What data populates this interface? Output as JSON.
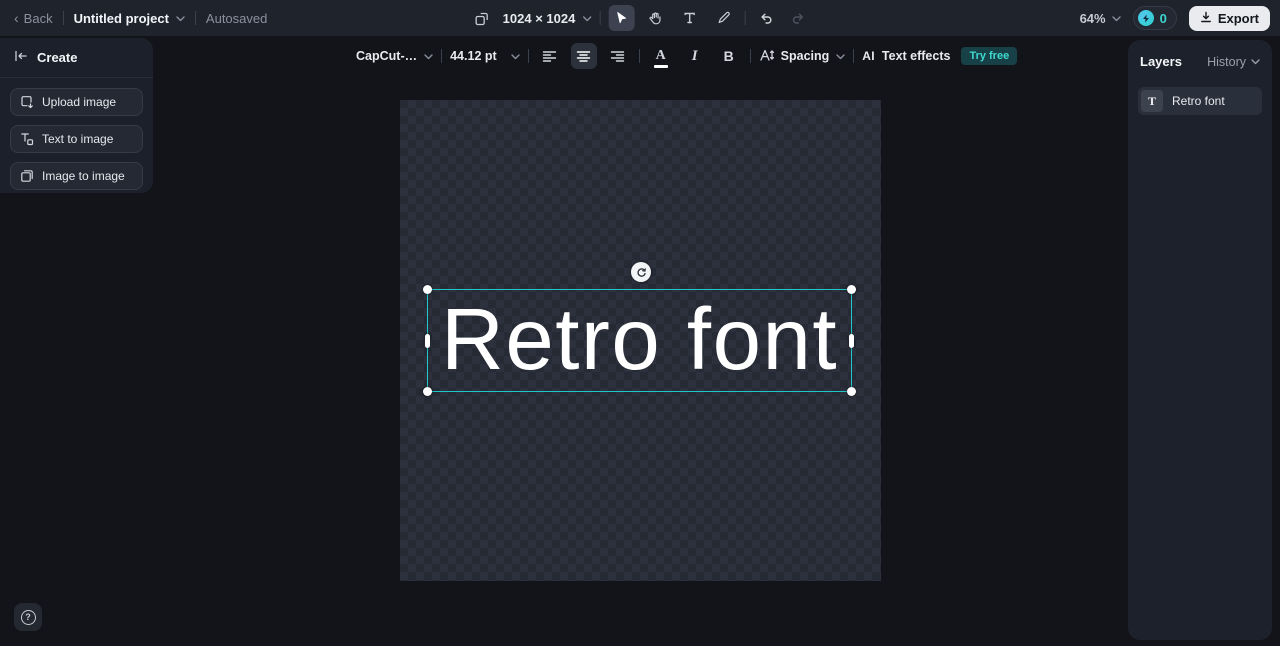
{
  "topbar": {
    "back_label": "Back",
    "project_name": "Untitled project",
    "autosaved_label": "Autosaved",
    "canvas_size": "1024 × 1024",
    "zoom_level": "64%",
    "credits_count": "0",
    "export_label": "Export"
  },
  "sidebar": {
    "title": "Create",
    "items": [
      {
        "label": "Upload image",
        "icon": "upload-image-icon"
      },
      {
        "label": "Text to image",
        "icon": "text-to-image-icon"
      },
      {
        "label": "Image to image",
        "icon": "image-to-image-icon"
      }
    ]
  },
  "toolbar": {
    "font_name": "CapCut-…",
    "font_size": "44.12 pt",
    "color_glyph": "A",
    "italic_glyph": "I",
    "bold_glyph": "B",
    "spacing_label": "Spacing",
    "ai_glyph": "AI",
    "text_effects_label": "Text effects",
    "try_free_label": "Try free"
  },
  "canvas": {
    "text": "Retro font"
  },
  "layers_panel": {
    "title": "Layers",
    "history_label": "History",
    "layers": [
      {
        "type_icon": "T",
        "name": "Retro font"
      }
    ]
  },
  "help": {
    "glyph": "?"
  },
  "colors": {
    "accent_teal": "#2ed9d0",
    "selection_border": "#1ec8c8",
    "try_free_badge_bg": "#174146",
    "topbar_bg": "#1f232c",
    "panel_bg": "#1b202a",
    "app_bg": "#121419",
    "export_button_bg": "#e9ebee"
  }
}
